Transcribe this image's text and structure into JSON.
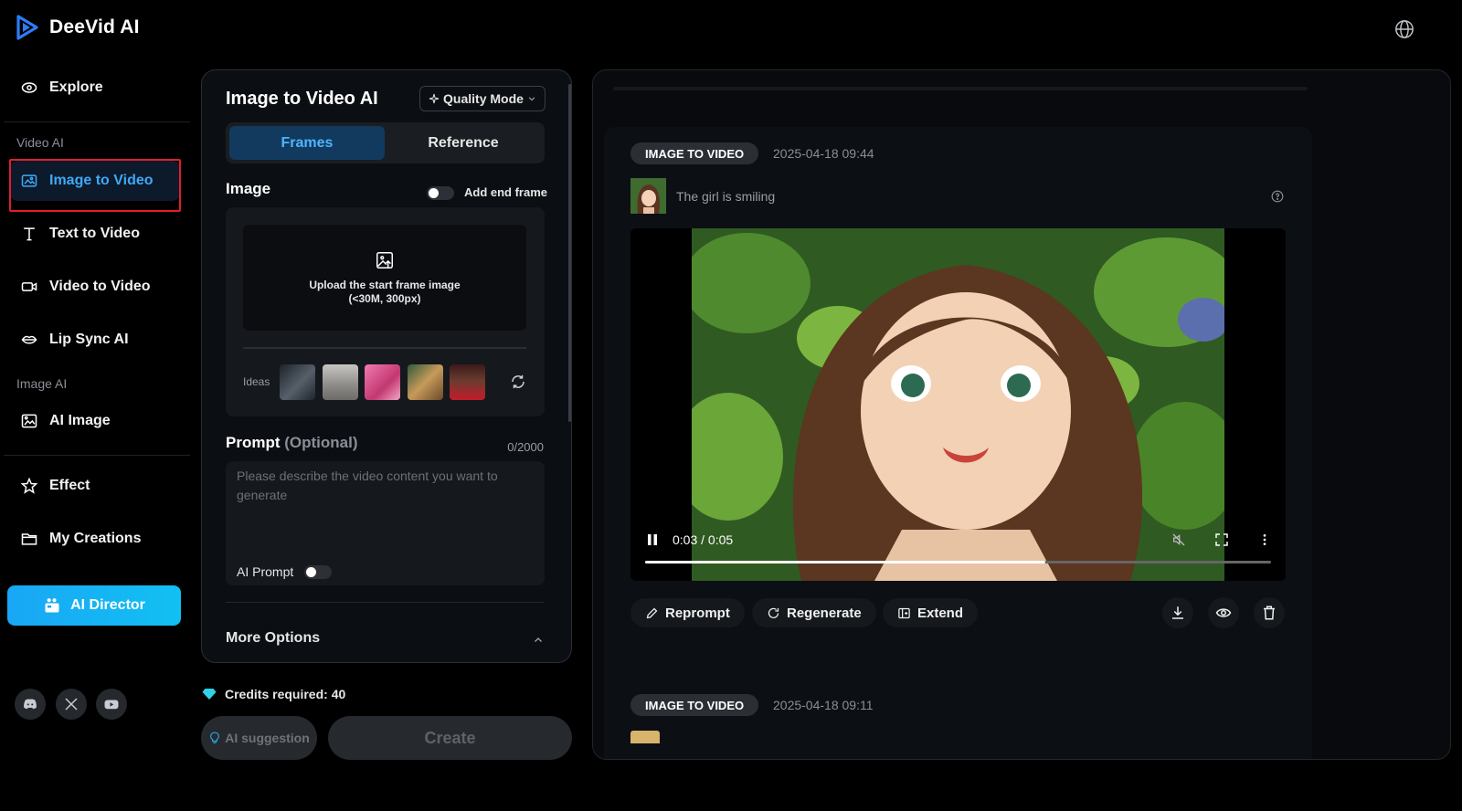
{
  "app": {
    "name": "DeeVid AI",
    "accent": "#3ea9f5"
  },
  "sidebar": {
    "explore": "Explore",
    "sections": {
      "video_ai": "Video AI",
      "image_ai": "Image AI"
    },
    "items": [
      {
        "label": "Image to Video",
        "icon": "image-icon",
        "active": true
      },
      {
        "label": "Text to Video",
        "icon": "text-icon"
      },
      {
        "label": "Video to Video",
        "icon": "video-camera-icon"
      },
      {
        "label": "Lip Sync AI",
        "icon": "lips-icon"
      },
      {
        "label": "AI Image",
        "icon": "image-edit-icon"
      },
      {
        "label": "Effect",
        "icon": "star-icon"
      },
      {
        "label": "My Creations",
        "icon": "folder-icon"
      }
    ],
    "ai_director": "AI Director",
    "social": [
      "discord-icon",
      "x-icon",
      "youtube-icon"
    ]
  },
  "form": {
    "title": "Image to Video AI",
    "quality_mode": "Quality Mode",
    "tabs": {
      "frames": "Frames",
      "reference": "Reference"
    },
    "image_label": "Image",
    "add_end_frame": "Add end frame",
    "upload_line1": "Upload the start frame image",
    "upload_line2": "(<30M, 300px)",
    "ideas_label": "Ideas",
    "ideas_colors": [
      "#3a4148",
      "#9a9896",
      "#e2619a",
      "#8a6a3a",
      "#b7202a"
    ],
    "prompt_label": "Prompt",
    "prompt_optional": "(Optional)",
    "prompt_count": "0/2000",
    "prompt_placeholder": "Please describe the video content you want to generate",
    "ai_prompt": "AI Prompt",
    "more_options": "More Options",
    "credits": "Credits required: 40",
    "ai_suggestion": "AI suggestion",
    "create": "Create"
  },
  "results": {
    "items": [
      {
        "badge": "IMAGE TO VIDEO",
        "date": "2025-04-18 09:44",
        "prompt": "The girl is smiling",
        "time": "0:03 / 0:05",
        "progress": 0.64
      },
      {
        "badge": "IMAGE TO VIDEO",
        "date": "2025-04-18 09:11"
      }
    ],
    "actions": {
      "reprompt": "Reprompt",
      "regenerate": "Regenerate",
      "extend": "Extend"
    }
  }
}
